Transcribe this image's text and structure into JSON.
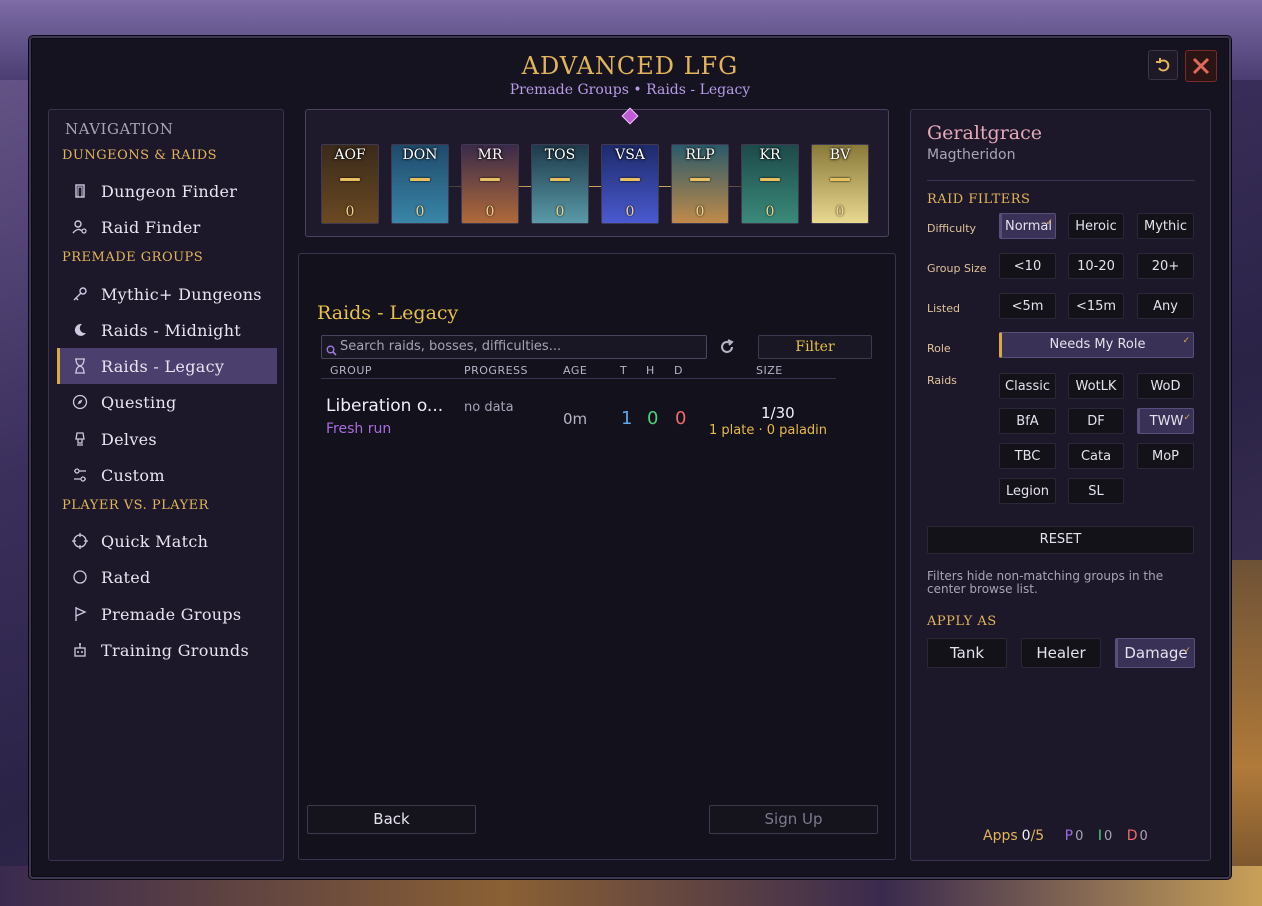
{
  "window": {
    "title": "ADVANCED LFG",
    "subtitle": "Premade Groups • Raids - Legacy",
    "refresh_icon": "undo-icon",
    "close_icon": "close-icon"
  },
  "nav": {
    "heading": "NAVIGATION",
    "sections": [
      {
        "label": "DUNGEONS & RAIDS"
      },
      {
        "label": "PREMADE GROUPS"
      },
      {
        "label": "PLAYER VS. PLAYER"
      }
    ],
    "items": [
      {
        "label": "Dungeon Finder",
        "icon": "door-icon"
      },
      {
        "label": "Raid Finder",
        "icon": "person-search-icon"
      },
      {
        "label": "Mythic+ Dungeons",
        "icon": "key-icon"
      },
      {
        "label": "Raids - Midnight",
        "icon": "moon-icon"
      },
      {
        "label": "Raids - Legacy",
        "icon": "hourglass-icon",
        "active": true
      },
      {
        "label": "Questing",
        "icon": "compass-icon"
      },
      {
        "label": "Delves",
        "icon": "lamp-icon"
      },
      {
        "label": "Custom",
        "icon": "sliders-icon"
      },
      {
        "label": "Quick Match",
        "icon": "crosshair-icon"
      },
      {
        "label": "Rated",
        "icon": "circle-icon"
      },
      {
        "label": "Premade Groups",
        "icon": "flag-icon"
      },
      {
        "label": "Training Grounds",
        "icon": "robot-icon"
      }
    ]
  },
  "raid_tiles": [
    {
      "abbr": "AOF",
      "count": "0",
      "color_top": "#3a2a1a",
      "color_bottom": "#6a4a22"
    },
    {
      "abbr": "DON",
      "count": "0",
      "color_top": "#1f4a6a",
      "color_bottom": "#3a86a8"
    },
    {
      "abbr": "MR",
      "count": "0",
      "color_top": "#3a2a4a",
      "color_bottom": "#b06a3a"
    },
    {
      "abbr": "TOS",
      "count": "0",
      "color_top": "#1d3a4a",
      "color_bottom": "#5a9aa8"
    },
    {
      "abbr": "VSA",
      "count": "0",
      "color_top": "#1d2a6a",
      "color_bottom": "#4a5ad0"
    },
    {
      "abbr": "RLP",
      "count": "0",
      "color_top": "#2a5a6a",
      "color_bottom": "#c08a4a"
    },
    {
      "abbr": "KR",
      "count": "0",
      "color_top": "#1d4a4a",
      "color_bottom": "#3a8a7a"
    },
    {
      "abbr": "BV",
      "count": "0",
      "color_top": "#8a7a3a",
      "color_bottom": "#e8d890"
    }
  ],
  "main": {
    "title": "Raids - Legacy",
    "search_placeholder": "Search raids, bosses, difficulties...",
    "filter_label": "Filter",
    "columns": {
      "group": "GROUP",
      "progress": "PROGRESS",
      "age": "AGE",
      "t": "T",
      "h": "H",
      "d": "D",
      "size": "SIZE"
    },
    "rows": [
      {
        "name": "Liberation o...",
        "sub": "Fresh run",
        "progress": "no data",
        "age": "0m",
        "t": "1",
        "h": "0",
        "d": "0",
        "size": "1/30",
        "composition": "1 plate · 0 paladin"
      }
    ],
    "back_label": "Back",
    "signup_label": "Sign Up"
  },
  "right": {
    "character": "Geraltgrace",
    "realm": "Magtheridon",
    "raid_filters_label": "RAID FILTERS",
    "difficulty": {
      "label": "Difficulty",
      "options": [
        "Normal",
        "Heroic",
        "Mythic"
      ],
      "selected": "Normal"
    },
    "group_size": {
      "label": "Group Size",
      "options": [
        "<10",
        "10-20",
        "20+"
      ]
    },
    "listed": {
      "label": "Listed",
      "options": [
        "<5m",
        "<15m",
        "Any"
      ]
    },
    "role": {
      "label": "Role",
      "value": "Needs My Role"
    },
    "raids": {
      "label": "Raids",
      "options": [
        "Classic",
        "WotLK",
        "WoD",
        "BfA",
        "DF",
        "TWW",
        "TBC",
        "Cata",
        "MoP",
        "Legion",
        "SL"
      ],
      "selected": "TWW"
    },
    "reset_label": "RESET",
    "hint": "Filters hide non-matching groups in the center browse list.",
    "apply_as_label": "APPLY AS",
    "apply_options": [
      "Tank",
      "Healer",
      "Damage"
    ],
    "apply_selected": "Damage",
    "apps": {
      "label": "Apps",
      "value": "0",
      "max": "/5",
      "p_label": "P",
      "p": "0",
      "i_label": "I",
      "i": "0",
      "d_label": "D",
      "d": "0"
    }
  }
}
